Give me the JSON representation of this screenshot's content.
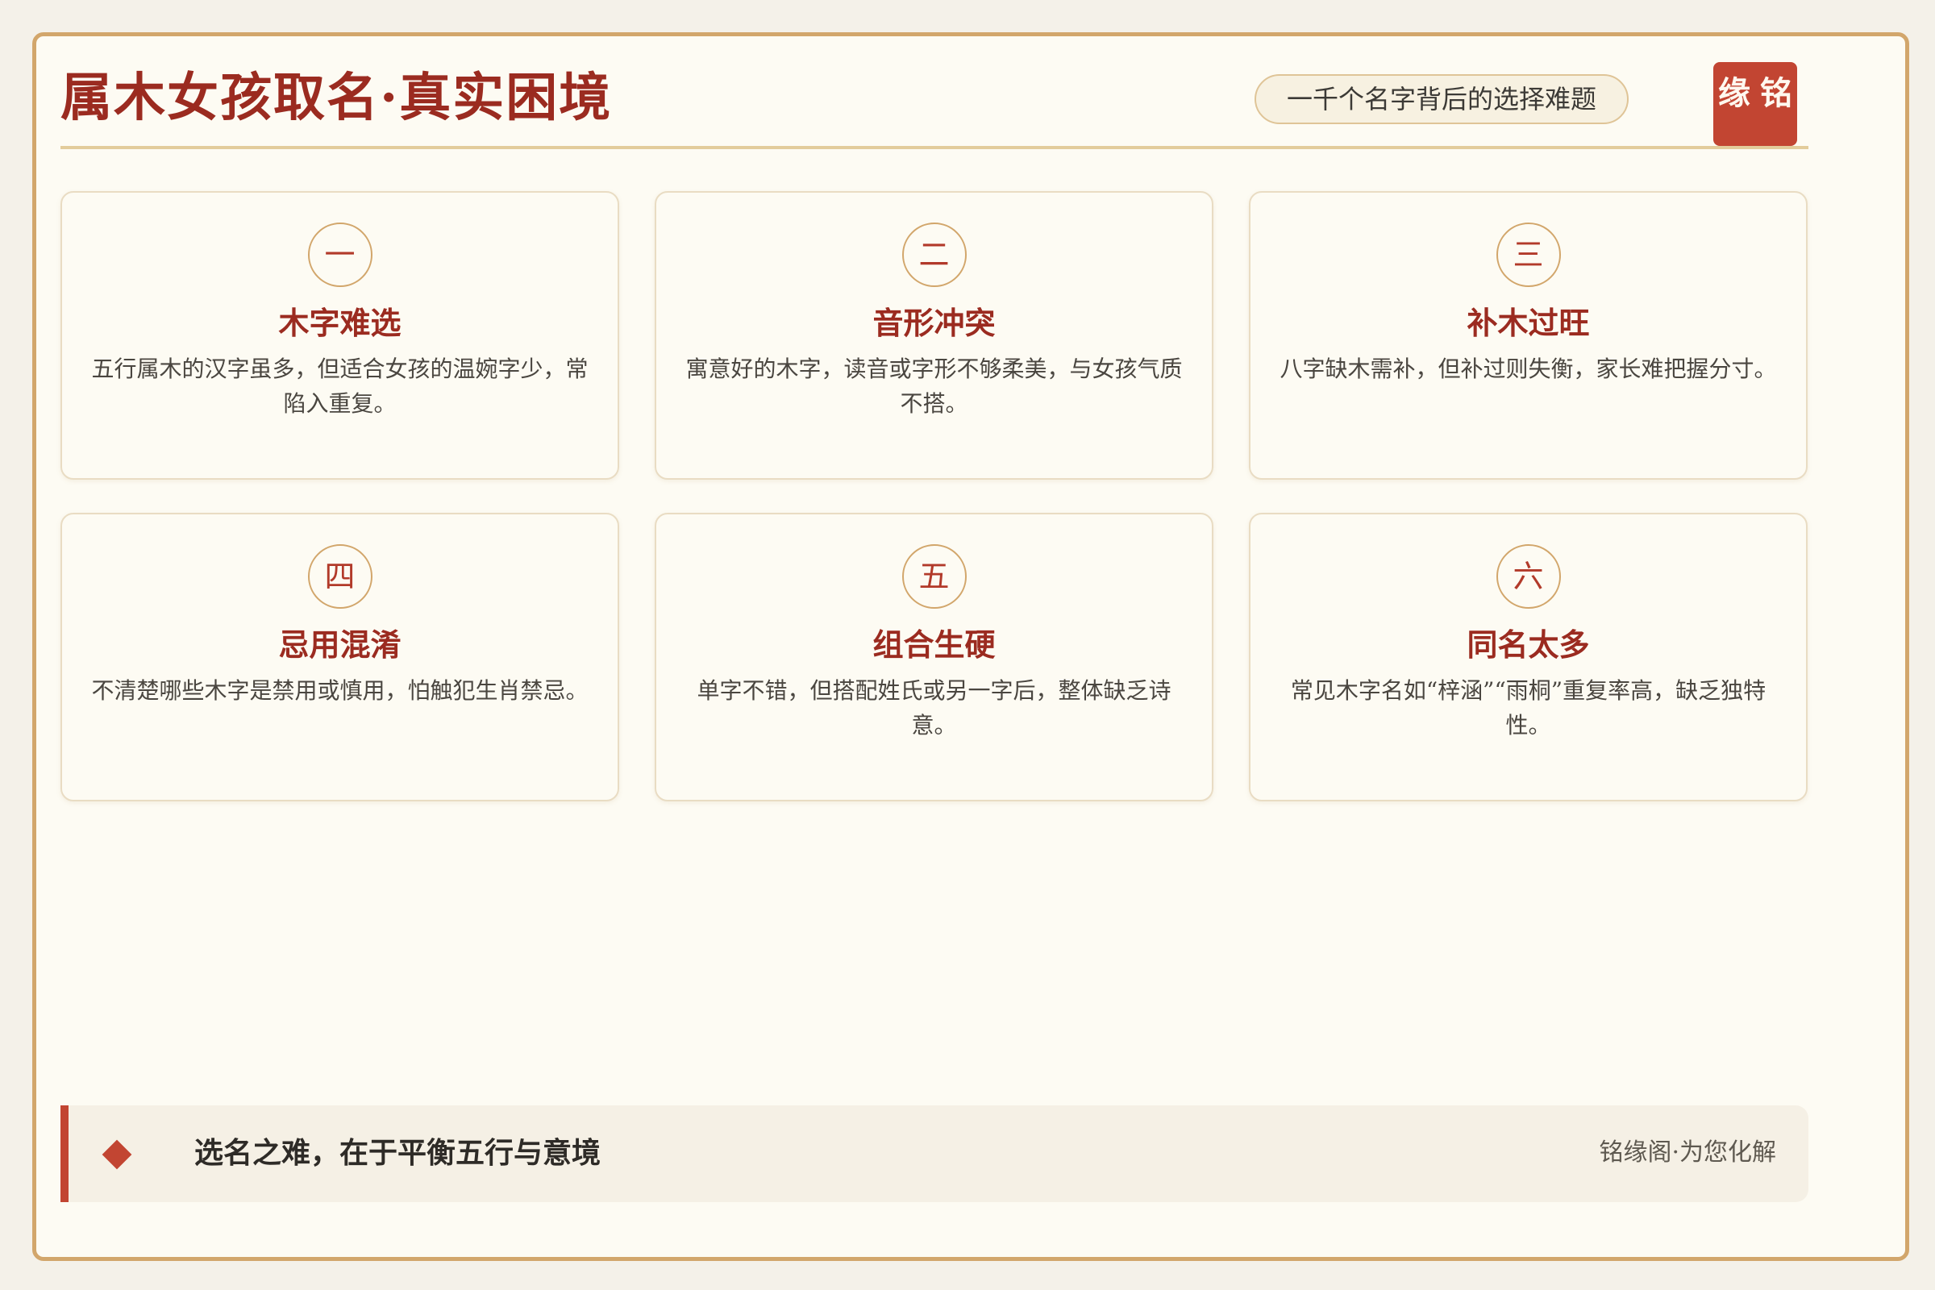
{
  "header": {
    "title": "属木女孩取名·真实困境",
    "subtitle": "一千个名字背后的选择难题",
    "seal_chars": [
      "缘",
      "铭"
    ]
  },
  "cards": [
    {
      "number": "一",
      "title": "木字难选",
      "desc": "五行属木的汉字虽多，但适合女孩的温婉字少，常陷入重复。"
    },
    {
      "number": "二",
      "title": "音形冲突",
      "desc": "寓意好的木字，读音或字形不够柔美，与女孩气质不搭。"
    },
    {
      "number": "三",
      "title": "补木过旺",
      "desc": "八字缺木需补，但补过则失衡，家长难把握分寸。"
    },
    {
      "number": "四",
      "title": "忌用混淆",
      "desc": "不清楚哪些木字是禁用或慎用，怕触犯生肖禁忌。"
    },
    {
      "number": "五",
      "title": "组合生硬",
      "desc": "单字不错，但搭配姓氏或另一字后，整体缺乏诗意。"
    },
    {
      "number": "六",
      "title": "同名太多",
      "desc": "常见木字名如“梓涵”“雨桐”重复率高，缺乏独特性。"
    }
  ],
  "footer": {
    "text": "选名之难，在于平衡五行与意境",
    "brand": "铭缘阁·为您化解"
  },
  "colors": {
    "accent_red": "#9b2b20",
    "seal_red": "#c24532",
    "gold_border": "#d2a66b",
    "background": "#fdfbf3"
  }
}
